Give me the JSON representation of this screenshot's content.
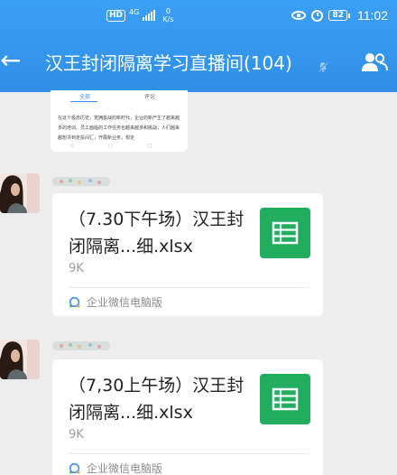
{
  "status_bar": {
    "hd_label": "HD",
    "network_label": "4G",
    "net_speed_value": "0",
    "net_speed_unit": "K/s",
    "battery_level": "82",
    "time": "11:02"
  },
  "title_bar": {
    "title": "汉王封闭隔离学习直播间(104)",
    "back_icon": "arrow-left-icon",
    "mute_icon": "bell-off-icon",
    "members_icon": "group-icon"
  },
  "image_message": {
    "tab_left": "全部",
    "tab_right": "评论",
    "text": "在这个极态历史，党拥拔战的新时代，企业的新产生了越来越多的培训。员工面临的工作任务也越来越多和挑战，人们越来越想寻到走投间汇，开展新业务，规定",
    "nav": "◁ ○ □"
  },
  "messages": [
    {
      "file_name": "（7.30下午场）汉王封闭隔离...细.xlsx",
      "file_size": "9K",
      "source": "企业微信电脑版",
      "file_icon": "spreadsheet-icon",
      "source_icon": "wework-icon"
    },
    {
      "file_name": "（7,30上午场）汉王封闭隔离...细.xlsx",
      "file_size": "9K",
      "source": "企业微信电脑版",
      "file_icon": "spreadsheet-icon",
      "source_icon": "wework-icon"
    }
  ],
  "colors": {
    "header": "#3398ee",
    "background": "#ededed",
    "excel": "#21ad5d"
  }
}
